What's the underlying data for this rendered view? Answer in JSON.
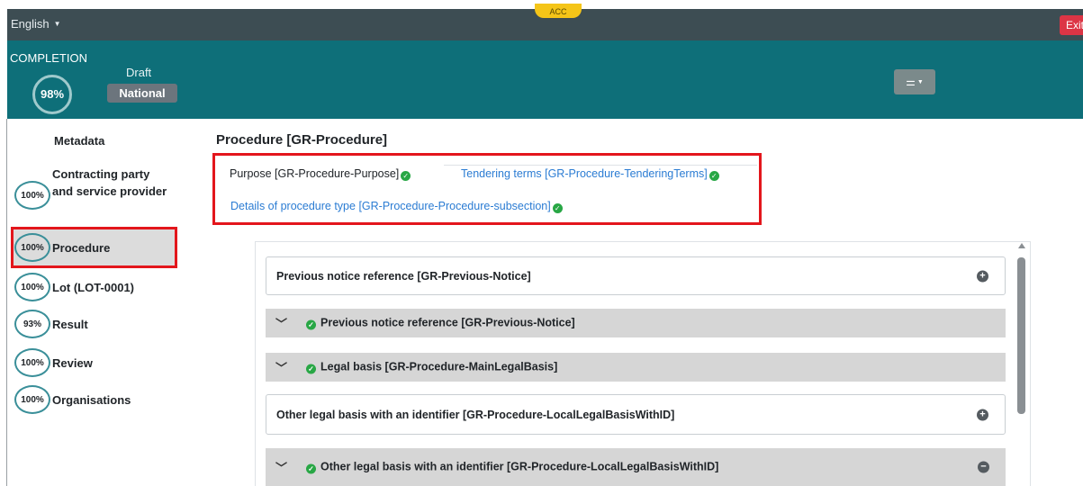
{
  "topbar": {
    "language": "English",
    "env_badge": "ACC",
    "exit_label": "Exit"
  },
  "status": {
    "completion_label": "COMPLETION",
    "completion_pct": "98%",
    "draft_label": "Draft",
    "national_label": "National"
  },
  "sidebar": {
    "items": [
      {
        "pct": "",
        "label": "Metadata"
      },
      {
        "pct": "100%",
        "label": "Contracting party and service provider"
      },
      {
        "pct": "100%",
        "label": "Procedure"
      },
      {
        "pct": "100%",
        "label": "Lot (LOT-0001)"
      },
      {
        "pct": "93%",
        "label": "Result"
      },
      {
        "pct": "100%",
        "label": "Review"
      },
      {
        "pct": "100%",
        "label": "Organisations"
      }
    ]
  },
  "main": {
    "title": "Procedure [GR-Procedure]",
    "tabs": [
      {
        "label": "Purpose  [GR-Procedure-Purpose]"
      },
      {
        "label": "Tendering terms  [GR-Procedure-TenderingTerms]"
      },
      {
        "label": "Details of procedure type  [GR-Procedure-Procedure-subsection]"
      }
    ],
    "sections": [
      {
        "label": "Previous notice reference  [GR-Previous-Notice]"
      },
      {
        "label": "Previous notice reference  [GR-Previous-Notice]"
      },
      {
        "label": "Legal basis  [GR-Procedure-MainLegalBasis]"
      },
      {
        "label": "Other legal basis with an identifier  [GR-Procedure-LocalLegalBasisWithID]"
      },
      {
        "label": "Other legal basis with an identifier  [GR-Procedure-LocalLegalBasisWithID]"
      }
    ]
  },
  "colors": {
    "topbar": "#3d4d53",
    "statusbar": "#0e6f79",
    "highlight": "#e3161c",
    "link": "#2b7cd3",
    "check": "#28a745"
  }
}
